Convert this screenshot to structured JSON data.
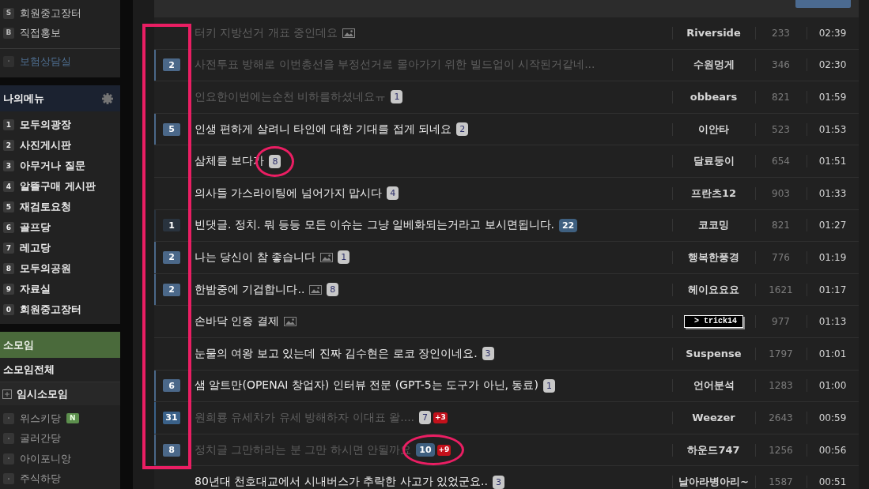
{
  "sidebar": {
    "links": [
      {
        "key": "S",
        "label": "회원중고장터",
        "kind": "board"
      },
      {
        "key": "B",
        "label": "직접홍보",
        "kind": "board"
      },
      {
        "key": "·",
        "label": "보험상담실",
        "kind": "partner"
      }
    ],
    "my_menu": {
      "title": "나의메뉴",
      "items": [
        {
          "key": "1",
          "label": "모두의광장"
        },
        {
          "key": "2",
          "label": "사진게시판"
        },
        {
          "key": "3",
          "label": "아무거나 질문"
        },
        {
          "key": "4",
          "label": "알뜰구매 게시판"
        },
        {
          "key": "5",
          "label": "재검토요청"
        },
        {
          "key": "6",
          "label": "골프당"
        },
        {
          "key": "7",
          "label": "레고당"
        },
        {
          "key": "8",
          "label": "모두의공원"
        },
        {
          "key": "9",
          "label": "자료실"
        },
        {
          "key": "0",
          "label": "회원중고장터"
        }
      ]
    },
    "groups": {
      "title": "소모임",
      "all_label": "소모임전체",
      "temporary": {
        "label": "임시소모임",
        "expanded": false
      },
      "items": [
        {
          "key": "·",
          "label": "위스키당",
          "new_badge": "N"
        },
        {
          "key": "·",
          "label": "굴러간당"
        },
        {
          "key": "·",
          "label": "아이포니앙"
        },
        {
          "key": "·",
          "label": "주식하당"
        }
      ]
    }
  },
  "markup": {
    "recommend_column_box": true
  },
  "posts": [
    {
      "visited": true,
      "title": "터키 지방선거 개표 중인데요",
      "attachments": [
        {
          "kind": "image"
        }
      ],
      "author": {
        "kind": "name",
        "text": "Riverside"
      },
      "views": "233",
      "time": "02:39"
    },
    {
      "recommend": {
        "count": "2",
        "color": "#4b6889"
      },
      "visited": true,
      "title": "사전투표 방해로 이번총선을 부정선거로 몰아가기 위한 빌드업이 시작된거같네...",
      "author": {
        "kind": "name",
        "text": "수원멍게"
      },
      "views": "346",
      "time": "02:30"
    },
    {
      "visited": true,
      "title": "인요한이번에는순천 비하를하셨네요ㅠ",
      "comments": {
        "kind": "plain",
        "count": "1",
        "circled": false
      },
      "author": {
        "kind": "name",
        "text": "obbears"
      },
      "views": "821",
      "time": "01:59"
    },
    {
      "recommend": {
        "count": "5",
        "color": "#4b6889"
      },
      "visited": false,
      "title": "인생 편하게 살려니 타인에 대한 기대를 접게 되네요",
      "comments": {
        "kind": "plain",
        "count": "2",
        "circled": false
      },
      "author": {
        "kind": "name",
        "text": "이안타"
      },
      "views": "523",
      "time": "01:53"
    },
    {
      "visited": false,
      "title": "삼체를 보다가",
      "comments": {
        "kind": "plain",
        "count": "8",
        "circled": true
      },
      "author": {
        "kind": "name",
        "text": "달료둥이"
      },
      "views": "654",
      "time": "01:51"
    },
    {
      "visited": false,
      "title": "의사들 가스라이팅에 넘어가지 맙시다",
      "comments": {
        "kind": "plain",
        "count": "4",
        "circled": false
      },
      "author": {
        "kind": "name",
        "text": "프란츠12"
      },
      "views": "903",
      "time": "01:33"
    },
    {
      "recommend": {
        "count": "1",
        "color": "#29333e"
      },
      "visited": false,
      "title": "빈댓글. 정치. 뭐 등등 모든 이슈는 그냥 일베화되는거라고 보시면됩니다.",
      "comments": {
        "kind": "hot",
        "count": "22",
        "circled": false
      },
      "author": {
        "kind": "name",
        "text": "코코밍"
      },
      "views": "821",
      "time": "01:27"
    },
    {
      "recommend": {
        "count": "2",
        "color": "#4b6889"
      },
      "visited": false,
      "title": "나는 당신이 참 좋습니다",
      "attachments": [
        {
          "kind": "image"
        }
      ],
      "comments": {
        "kind": "plain",
        "count": "1",
        "circled": false
      },
      "author": {
        "kind": "name",
        "text": "행복한풍경"
      },
      "views": "776",
      "time": "01:19"
    },
    {
      "recommend": {
        "count": "2",
        "color": "#4b6889"
      },
      "visited": false,
      "title": "한밤중에 기겁합니다..",
      "attachments": [
        {
          "kind": "image"
        }
      ],
      "comments": {
        "kind": "plain",
        "count": "8",
        "circled": false
      },
      "author": {
        "kind": "name",
        "text": "헤이요요요"
      },
      "views": "1621",
      "time": "01:17"
    },
    {
      "visited": false,
      "title": "손바닥 인증 결제",
      "attachments": [
        {
          "kind": "image"
        }
      ],
      "author": {
        "kind": "nick_image",
        "text": "> trick14"
      },
      "views": "977",
      "time": "01:13"
    },
    {
      "visited": false,
      "title": "눈물의 여왕 보고 있는데 진짜 김수현은 로코 장인이네요.",
      "comments": {
        "kind": "plain",
        "count": "3",
        "circled": false
      },
      "author": {
        "kind": "name",
        "text": "Suspense"
      },
      "views": "1797",
      "time": "01:01"
    },
    {
      "recommend": {
        "count": "6",
        "color": "#4b6889"
      },
      "visited": false,
      "title": "샘 알트만(OPENAI 창업자) 인터뷰 전문 (GPT-5는 도구가 아닌, 동료)",
      "comments": {
        "kind": "plain",
        "count": "1",
        "circled": false
      },
      "author": {
        "kind": "name",
        "text": "언어분석"
      },
      "views": "1283",
      "time": "01:00"
    },
    {
      "recommend": {
        "count": "31",
        "color": "#3a6189"
      },
      "visited": true,
      "title": "원희룡 유세차가 유세 방해하자 이대표 왈....",
      "comments": {
        "kind": "plain",
        "count": "7",
        "circled": false
      },
      "new_comments": "+3",
      "author": {
        "kind": "name",
        "text": "Weezer"
      },
      "views": "2643",
      "time": "00:59"
    },
    {
      "recommend": {
        "count": "8",
        "color": "#4b6889"
      },
      "visited": true,
      "title": "정치글 그만하라는 분 그만 하시면 안될까요",
      "comments": {
        "kind": "hot",
        "count": "10",
        "circled": true
      },
      "new_comments": "+9",
      "author": {
        "kind": "name",
        "text": "하운드747"
      },
      "views": "1256",
      "time": "00:56"
    },
    {
      "visited": false,
      "title": "80년대 천호대교에서 시내버스가 추락한 사고가 있었군요..",
      "comments": {
        "kind": "plain",
        "count": "3",
        "circled": false
      },
      "author": {
        "kind": "name",
        "text": "날아라병아리~"
      },
      "views": "1587",
      "time": "00:51"
    }
  ]
}
